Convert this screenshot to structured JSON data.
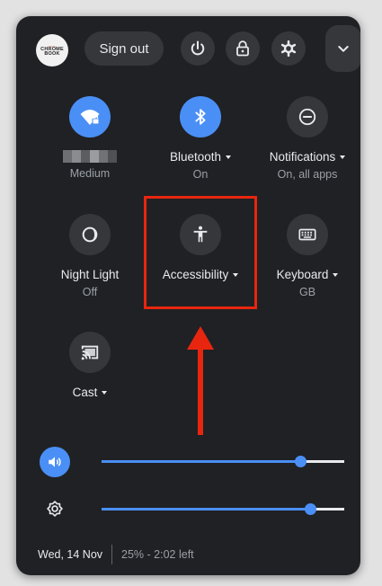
{
  "header": {
    "avatar_top": "........",
    "avatar_text": "CHROME BOOK",
    "sign_out_label": "Sign out",
    "icons": [
      "power-icon",
      "lock-icon",
      "settings-icon",
      "chevron-down-icon"
    ]
  },
  "tiles": [
    {
      "name": "wifi",
      "label": "",
      "sub": "Medium",
      "icon": "wifi-icon",
      "active": true,
      "has_caret": false
    },
    {
      "name": "bluetooth",
      "label": "Bluetooth",
      "sub": "On",
      "icon": "bluetooth-icon",
      "active": true,
      "has_caret": true
    },
    {
      "name": "notifications",
      "label": "Notifications",
      "sub": "On, all apps",
      "icon": "do-not-disturb-icon",
      "active": false,
      "has_caret": true
    },
    {
      "name": "night-light",
      "label": "Night Light",
      "sub": "Off",
      "icon": "night-light-icon",
      "active": false,
      "has_caret": false
    },
    {
      "name": "accessibility",
      "label": "Accessibility",
      "sub": "",
      "icon": "accessibility-icon",
      "active": false,
      "has_caret": true
    },
    {
      "name": "keyboard",
      "label": "Keyboard",
      "sub": "GB",
      "icon": "keyboard-icon",
      "active": false,
      "has_caret": true
    },
    {
      "name": "cast",
      "label": "Cast",
      "sub": "",
      "icon": "cast-icon",
      "active": false,
      "has_caret": true
    }
  ],
  "sliders": {
    "volume": {
      "level": 0.82,
      "icon": "volume-icon"
    },
    "brightness": {
      "level": 0.86,
      "icon": "brightness-icon"
    }
  },
  "footer": {
    "date": "Wed, 14 Nov",
    "battery": "25% - 2:02 left"
  },
  "colors": {
    "panel_bg": "#202124",
    "button_bg": "#36373a",
    "accent": "#4a8ff5",
    "annotation": "#e8260f"
  }
}
